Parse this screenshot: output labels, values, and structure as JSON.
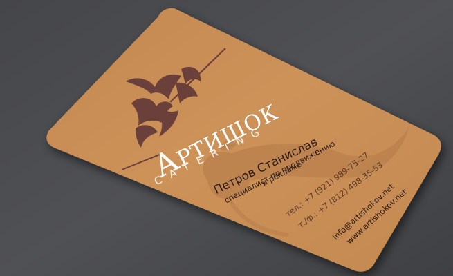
{
  "card": {
    "brand": "Артишок",
    "tagline": "CATERING",
    "person_name": "Петров Станислав",
    "position_line1": "специалист по продвижению",
    "position_line2": "и рекламе",
    "phone_mobile": "тел.: +7 (921) 989-75-27",
    "phone_office": "т./ф.: +7 (812) 498-35-53",
    "email": "info@artishokov.net",
    "website": "www.artishokov.net"
  },
  "colors": {
    "surface": "#4a4b4e",
    "card": "#c88d55",
    "logo_brown": "#6b3f3a",
    "text_dark": "#2a1a14"
  }
}
